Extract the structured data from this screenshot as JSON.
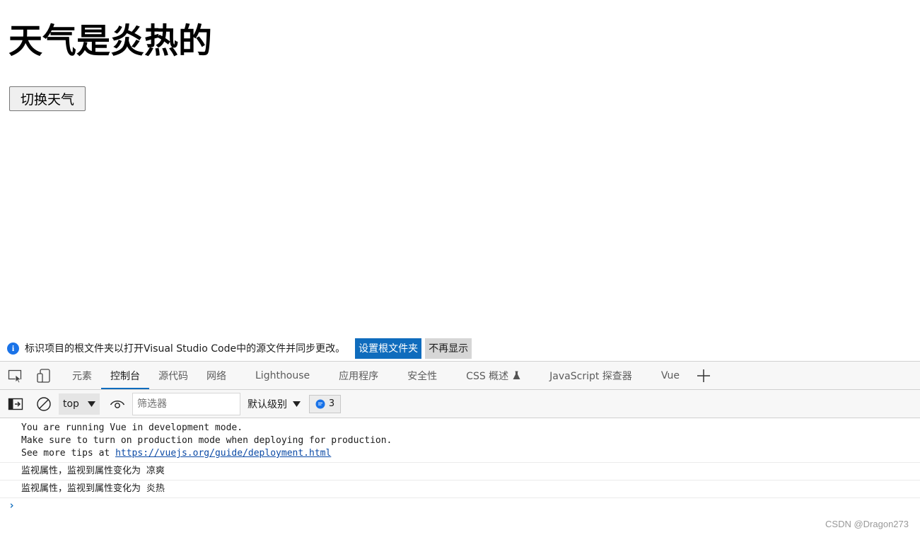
{
  "page": {
    "title": "天气是炎热的",
    "button_label": "切换天气"
  },
  "infobar": {
    "message": "标识项目的根文件夹以打开Visual Studio Code中的源文件并同步更改。",
    "primary_label": "设置根文件夹",
    "secondary_label": "不再显示"
  },
  "devtools": {
    "tabs": [
      {
        "label": "元素"
      },
      {
        "label": "控制台"
      },
      {
        "label": "源代码"
      },
      {
        "label": "网络"
      },
      {
        "label": "Lighthouse"
      },
      {
        "label": "应用程序"
      },
      {
        "label": "安全性"
      },
      {
        "label": "CSS 概述"
      },
      {
        "label": "JavaScript 探查器"
      },
      {
        "label": "Vue"
      }
    ],
    "active_tab": "控制台"
  },
  "toolbar": {
    "context": "top",
    "filter_placeholder": "筛选器",
    "level": "默认级别",
    "message_count": "3"
  },
  "console": {
    "vue_notice": {
      "line1": "You are running Vue in development mode.",
      "line2": "Make sure to turn on production mode when deploying for production.",
      "line3_prefix": "See more tips at ",
      "line3_link": "https://vuejs.org/guide/deployment.html"
    },
    "logs": [
      "监视属性，监视到属性变化为 凉爽",
      "监视属性，监视到属性变化为 炎热"
    ]
  },
  "watermark": "CSDN @Dragon273",
  "colors": {
    "accent": "#0f6cbd",
    "info": "#1a73e8",
    "link": "#0b4aa6"
  }
}
